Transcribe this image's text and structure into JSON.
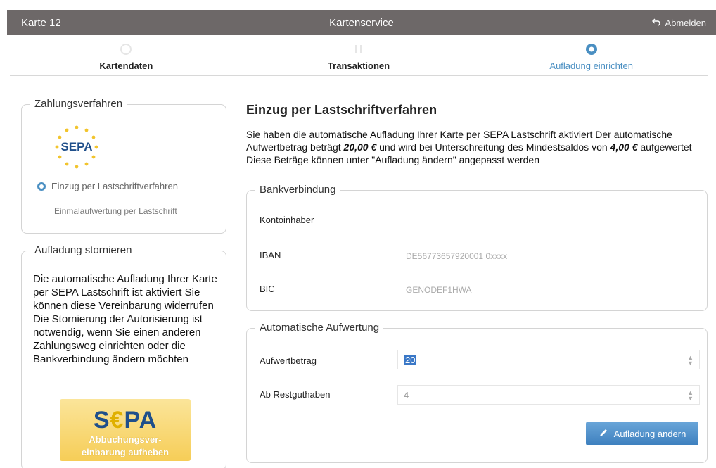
{
  "header": {
    "card": "Karte 12",
    "title": "Kartenservice",
    "logout": "Abmelden"
  },
  "steps": [
    {
      "label": "Kartendaten"
    },
    {
      "label": "Transaktionen"
    },
    {
      "label": "Aufladung einrichten"
    }
  ],
  "payment": {
    "legend": "Zahlungsverfahren",
    "sepa_logo": "SEPA",
    "option_direct_debit": "Einzug per Lastschriftverfahren",
    "option_onetime": "Einmalaufwertung per Lastschrift"
  },
  "cancel": {
    "legend": "Aufladung stornieren",
    "text1": "Die automatische Aufladung Ihrer Karte per SEPA Lastschrift ist aktiviert  Sie können diese Vereinbarung widerrufen",
    "text2": "Die Stornierung der Autorisierung ist notwendig, wenn Sie einen anderen Zahlungsweg einrichten oder die Bankverbindung ändern möchten",
    "button_logo_s": "S",
    "button_logo_euro": "€",
    "button_logo_pa": "PA",
    "button_line1": "Abbuchungsver-",
    "button_line2": "einbarung aufheben"
  },
  "main": {
    "heading": "Einzug per Lastschriftverfahren",
    "intro_a": "Sie haben die automatische Aufladung Ihrer Karte per SEPA Lastschrift aktiviert  Der automatische Aufwertbetrag beträgt ",
    "amount": "20,00 €",
    "intro_b": " und wird bei Unterschreitung des Mindestsaldos von ",
    "min": "4,00 €",
    "intro_c": " aufgewertet  Diese Beträge können unter \"Aufladung ändern\" angepasst werden"
  },
  "bank": {
    "legend": "Bankverbindung",
    "owner_label": "Kontoinhaber",
    "owner_value": "",
    "iban_label": "IBAN",
    "iban_value": "DE56773657920001 0xxxx",
    "bic_label": "BIC",
    "bic_value": "GENODEF1HWA"
  },
  "auto": {
    "legend": "Automatische Aufwertung",
    "amount_label": "Aufwertbetrag",
    "amount_value": "20",
    "rest_label": "Ab Restguthaben",
    "rest_value": "4",
    "button": "Aufladung ändern"
  },
  "colors": {
    "topbar": "#6d6868",
    "accent": "#4a8fc2",
    "sepa_yellow": "#f6cd57"
  }
}
